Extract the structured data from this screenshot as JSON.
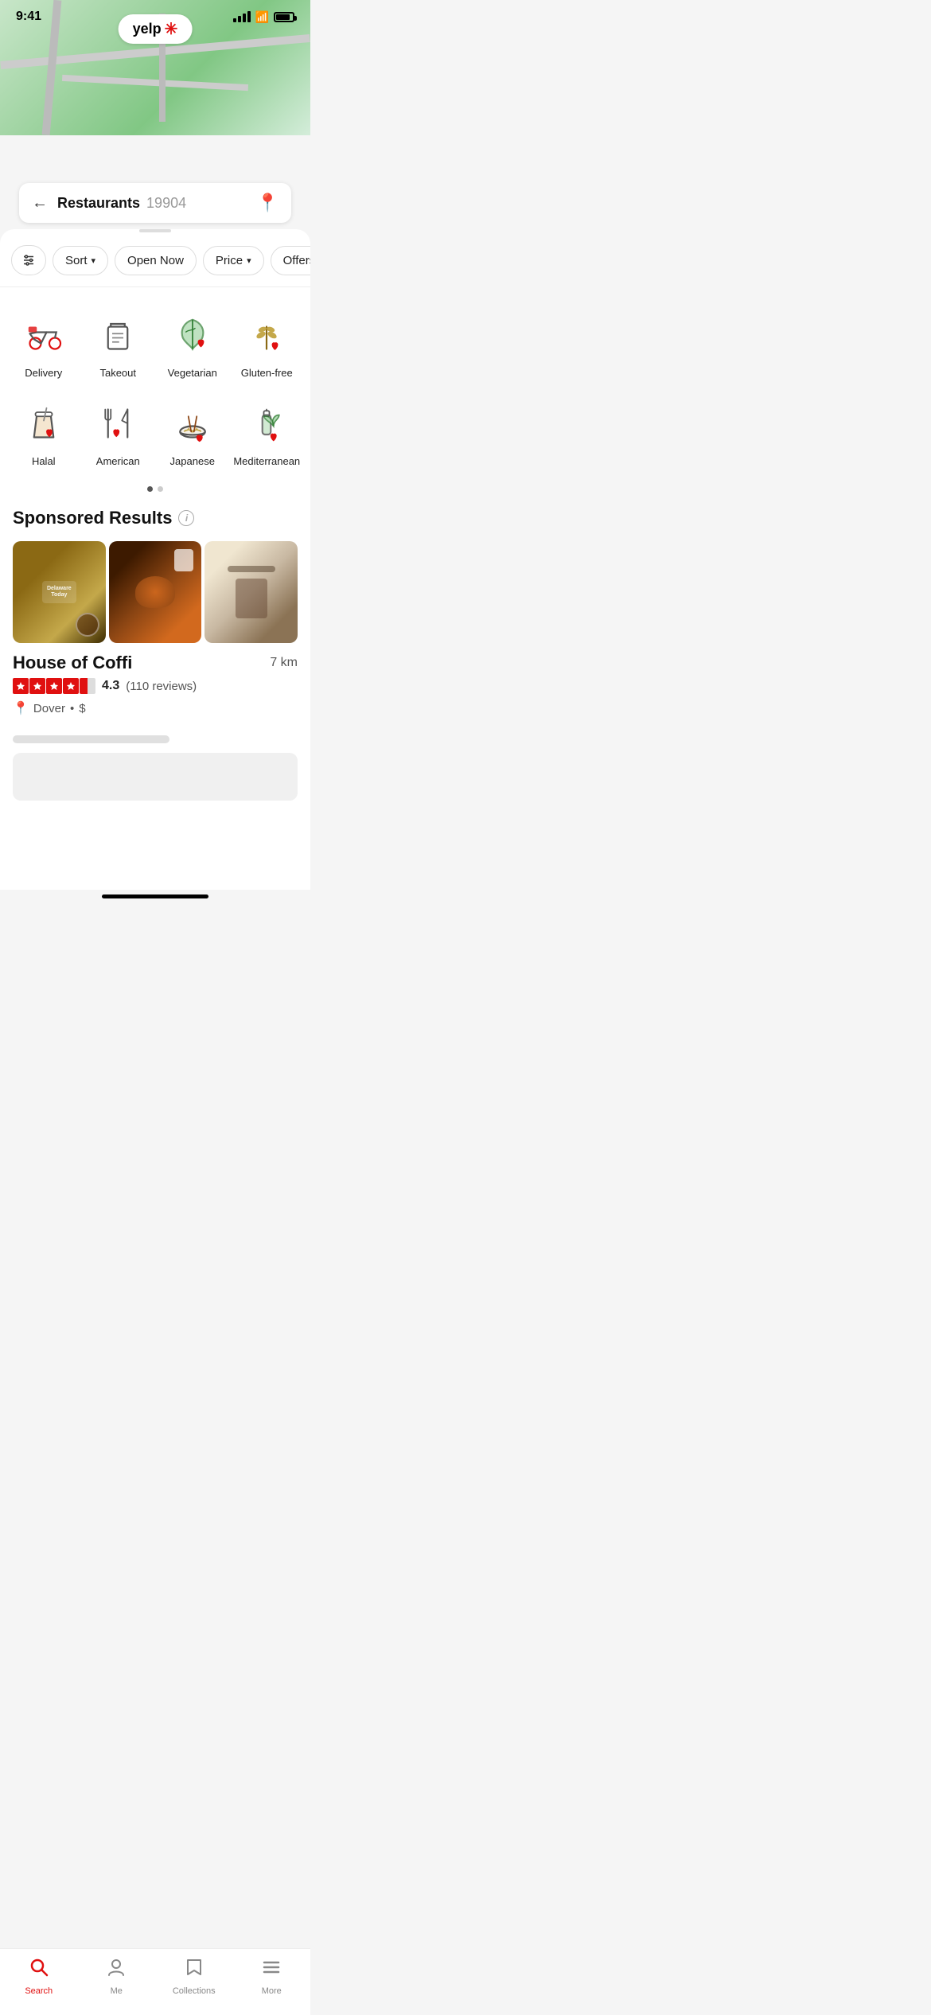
{
  "statusBar": {
    "time": "9:41"
  },
  "header": {
    "backLabel": "←",
    "searchMain": "Restaurants",
    "searchZip": "19904"
  },
  "filters": [
    {
      "id": "adjust",
      "label": "⊞",
      "iconOnly": true
    },
    {
      "id": "sort",
      "label": "Sort",
      "hasChevron": true
    },
    {
      "id": "open-now",
      "label": "Open Now",
      "hasChevron": false
    },
    {
      "id": "price",
      "label": "Price",
      "hasChevron": true
    },
    {
      "id": "offers",
      "label": "Offers Take…",
      "hasChevron": false
    }
  ],
  "categories": [
    {
      "id": "delivery",
      "label": "Delivery"
    },
    {
      "id": "takeout",
      "label": "Takeout"
    },
    {
      "id": "vegetarian",
      "label": "Vegetarian"
    },
    {
      "id": "gluten-free",
      "label": "Gluten-free"
    },
    {
      "id": "halal",
      "label": "Halal"
    },
    {
      "id": "american",
      "label": "American"
    },
    {
      "id": "japanese",
      "label": "Japanese"
    },
    {
      "id": "mediterranean",
      "label": "Mediterranean"
    }
  ],
  "sponsored": {
    "title": "Sponsored Results",
    "infoLabel": "i"
  },
  "restaurant": {
    "name": "House of Coffi",
    "distance": "7 km",
    "rating": "4.3",
    "reviewCount": "(110 reviews)",
    "location": "Dover",
    "priceLevel": "$"
  },
  "tabs": [
    {
      "id": "search",
      "label": "Search",
      "icon": "🔍",
      "active": true
    },
    {
      "id": "me",
      "label": "Me",
      "icon": "👤",
      "active": false
    },
    {
      "id": "collections",
      "label": "Collections",
      "icon": "🔖",
      "active": false
    },
    {
      "id": "more",
      "label": "More",
      "icon": "☰",
      "active": false
    }
  ]
}
